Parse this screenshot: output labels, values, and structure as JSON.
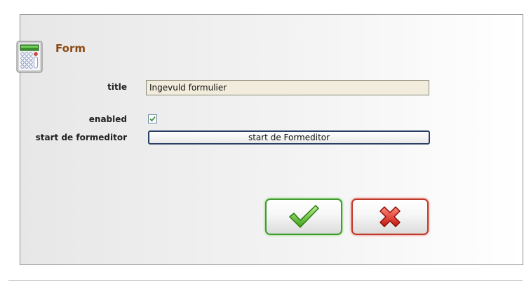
{
  "form": {
    "title": "Form",
    "icon": "calculator-icon"
  },
  "fields": {
    "title_label": "title",
    "title_value": "Ingevuld formulier",
    "enabled_label": "enabled",
    "enabled_checked": true,
    "formeditor_label": "start de formeditor",
    "formeditor_button": "start de Formeditor"
  },
  "actions": {
    "ok_icon": "checkmark-icon",
    "cancel_icon": "cross-icon"
  },
  "colors": {
    "title_brown": "#8b4a12",
    "ok_border": "#3f9c2e",
    "cancel_border": "#c0392b",
    "input_bg": "#f1ecdc",
    "button_border": "#2a3e66"
  }
}
